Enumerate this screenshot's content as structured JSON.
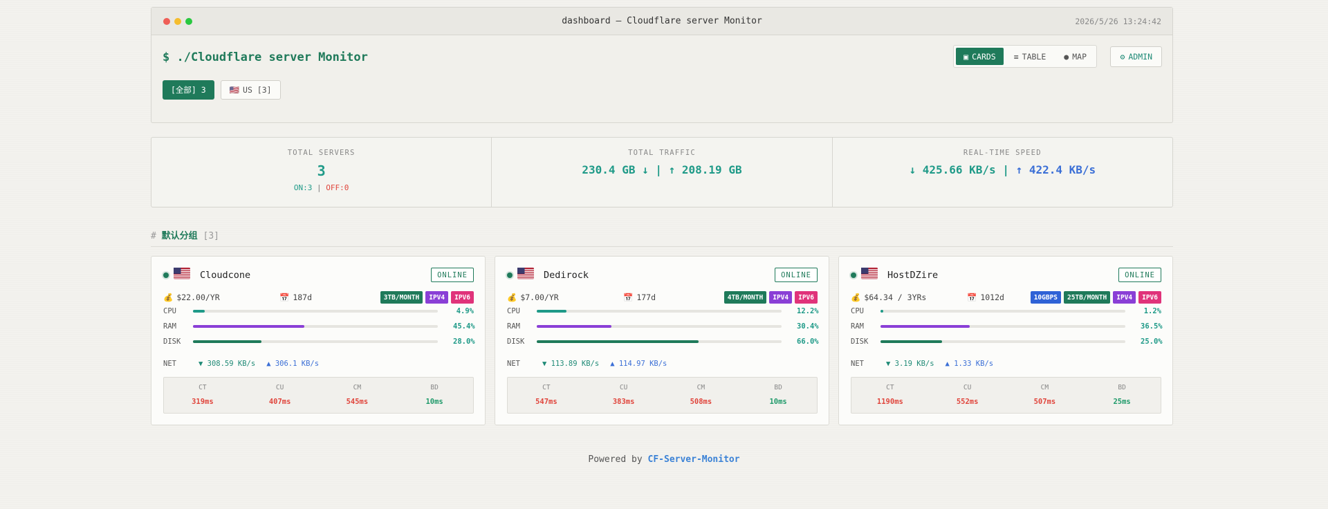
{
  "window": {
    "title": "dashboard — Cloudflare server Monitor",
    "datetime": "2026/5/26 13:24:42"
  },
  "header": {
    "app_title": "$ ./Cloudflare server Monitor",
    "views": [
      {
        "icon": "▣",
        "label": "CARDS",
        "active": true
      },
      {
        "icon": "≡",
        "label": "TABLE",
        "active": false
      },
      {
        "icon": "●",
        "label": "MAP",
        "active": false
      }
    ],
    "admin": {
      "icon": "⚙",
      "label": "ADMIN"
    },
    "filters": {
      "all_label": "[全部] 3",
      "us_flag": "🇺🇸",
      "us_label": "US [3]"
    }
  },
  "stats": {
    "servers": {
      "label": "TOTAL SERVERS",
      "value": "3",
      "on": "ON:3",
      "sep": "|",
      "off": "OFF:0"
    },
    "traffic": {
      "label": "TOTAL TRAFFIC",
      "value": "230.4 GB ↓ | ↑ 208.19 GB"
    },
    "speed": {
      "label": "REAL-TIME SPEED",
      "down": "↓ 425.66 KB/s",
      "sep": "|",
      "up": "↑ 422.4 KB/s"
    }
  },
  "group": {
    "hash": "#",
    "name": "默认分组",
    "count": "[3]"
  },
  "colors": {
    "accent": "#1f7a5a",
    "cpu": "#1f9a88",
    "ram": "#8a3fd6",
    "disk": "#1f7a5a",
    "good_ping": "#1f9a6a",
    "bad_ping": "#e0453c"
  },
  "servers": [
    {
      "flag": "🇺🇸",
      "name": "Cloudcone",
      "status": "ONLINE",
      "price_icon": "💰",
      "price": "$22.00/YR",
      "days_icon": "📅",
      "days": "187d",
      "tags": [
        {
          "label": "3TB/MONTH",
          "color": "#1f7a5a"
        },
        {
          "label": "IPV4",
          "color": "#8a3fd6"
        },
        {
          "label": "IPV6",
          "color": "#e0337a"
        }
      ],
      "cpu_label": "CPU",
      "cpu": "4.9%",
      "cpu_pct": 4.9,
      "ram_label": "RAM",
      "ram": "45.4%",
      "ram_pct": 45.4,
      "disk_label": "DISK",
      "disk": "28.0%",
      "disk_pct": 28.0,
      "net_label": "NET",
      "net_down": "▼ 308.59 KB/s",
      "net_up": "▲ 306.1 KB/s",
      "pings": [
        {
          "label": "CT",
          "value": "319ms",
          "good": false
        },
        {
          "label": "CU",
          "value": "407ms",
          "good": false
        },
        {
          "label": "CM",
          "value": "545ms",
          "good": false
        },
        {
          "label": "BD",
          "value": "10ms",
          "good": true
        }
      ]
    },
    {
      "flag": "🇺🇸",
      "name": "Dedirock",
      "status": "ONLINE",
      "price_icon": "💰",
      "price": "$7.00/YR",
      "days_icon": "📅",
      "days": "177d",
      "tags": [
        {
          "label": "4TB/MONTH",
          "color": "#1f7a5a"
        },
        {
          "label": "IPV4",
          "color": "#8a3fd6"
        },
        {
          "label": "IPV6",
          "color": "#e0337a"
        }
      ],
      "cpu_label": "CPU",
      "cpu": "12.2%",
      "cpu_pct": 12.2,
      "ram_label": "RAM",
      "ram": "30.4%",
      "ram_pct": 30.4,
      "disk_label": "DISK",
      "disk": "66.0%",
      "disk_pct": 66.0,
      "net_label": "NET",
      "net_down": "▼ 113.89 KB/s",
      "net_up": "▲ 114.97 KB/s",
      "pings": [
        {
          "label": "CT",
          "value": "547ms",
          "good": false
        },
        {
          "label": "CU",
          "value": "383ms",
          "good": false
        },
        {
          "label": "CM",
          "value": "508ms",
          "good": false
        },
        {
          "label": "BD",
          "value": "10ms",
          "good": true
        }
      ]
    },
    {
      "flag": "🇺🇸",
      "name": "HostDZire",
      "status": "ONLINE",
      "price_icon": "💰",
      "price": "$64.34 / 3YRs",
      "days_icon": "📅",
      "days": "1012d",
      "tags": [
        {
          "label": "10GBPS",
          "color": "#2f62d6"
        },
        {
          "label": "25TB/MONTH",
          "color": "#1f7a5a"
        },
        {
          "label": "IPV4",
          "color": "#8a3fd6"
        },
        {
          "label": "IPV6",
          "color": "#e0337a"
        }
      ],
      "cpu_label": "CPU",
      "cpu": "1.2%",
      "cpu_pct": 1.2,
      "ram_label": "RAM",
      "ram": "36.5%",
      "ram_pct": 36.5,
      "disk_label": "DISK",
      "disk": "25.0%",
      "disk_pct": 25.0,
      "net_label": "NET",
      "net_down": "▼ 3.19 KB/s",
      "net_up": "▲ 1.33 KB/s",
      "pings": [
        {
          "label": "CT",
          "value": "1190ms",
          "good": false
        },
        {
          "label": "CU",
          "value": "552ms",
          "good": false
        },
        {
          "label": "CM",
          "value": "507ms",
          "good": false
        },
        {
          "label": "BD",
          "value": "25ms",
          "good": true
        }
      ]
    }
  ],
  "footer": {
    "prefix": "Powered by",
    "link": "CF-Server-Monitor"
  }
}
